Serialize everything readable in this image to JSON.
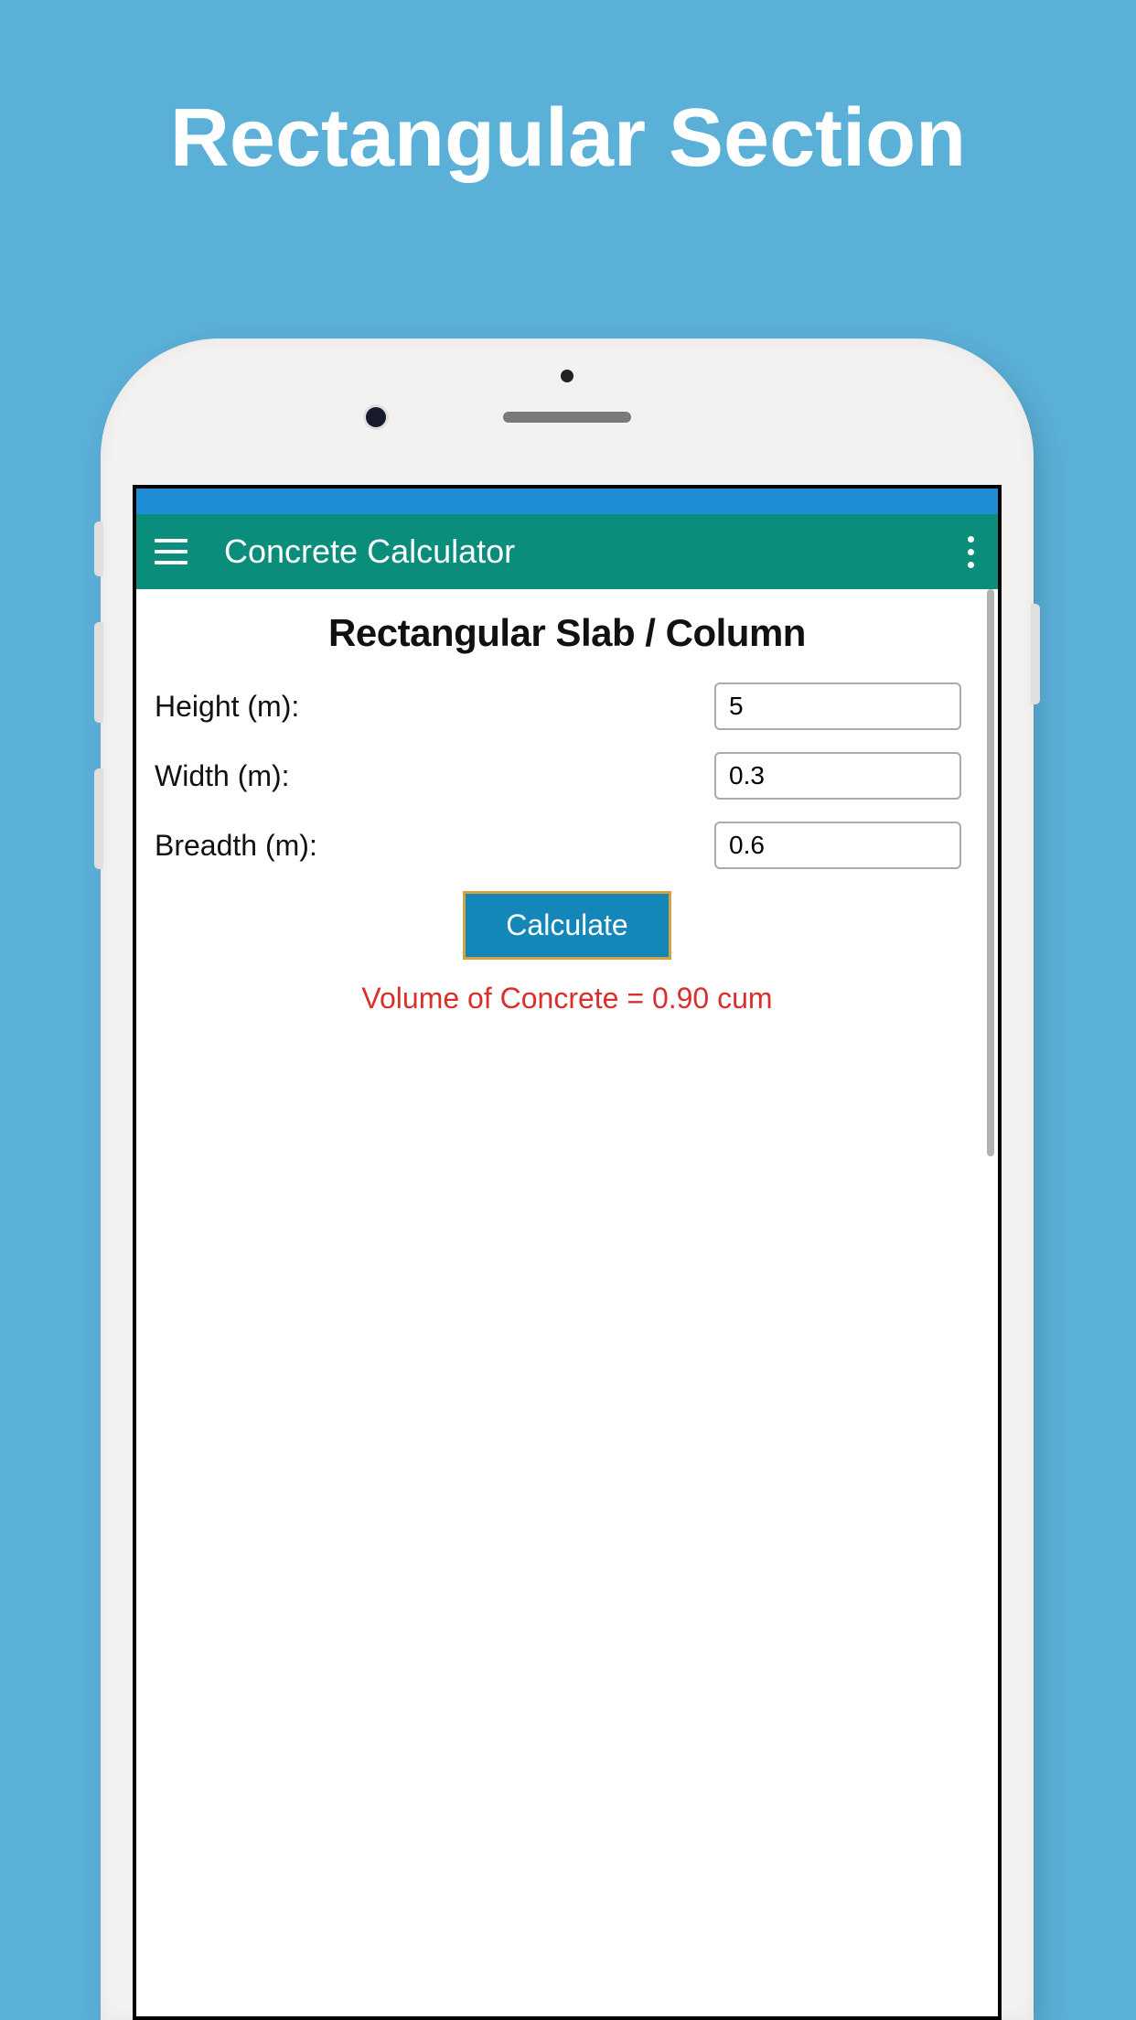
{
  "promo": {
    "title": "Rectangular Section"
  },
  "appbar": {
    "title": "Concrete Calculator"
  },
  "page": {
    "heading": "Rectangular Slab / Column"
  },
  "form": {
    "height": {
      "label": "Height (m):",
      "value": "5"
    },
    "width": {
      "label": "Width (m):",
      "value": "0.3"
    },
    "breadth": {
      "label": "Breadth (m):",
      "value": "0.6"
    },
    "calculate_label": "Calculate"
  },
  "result": {
    "text": "Volume of Concrete = 0.90 cum"
  }
}
